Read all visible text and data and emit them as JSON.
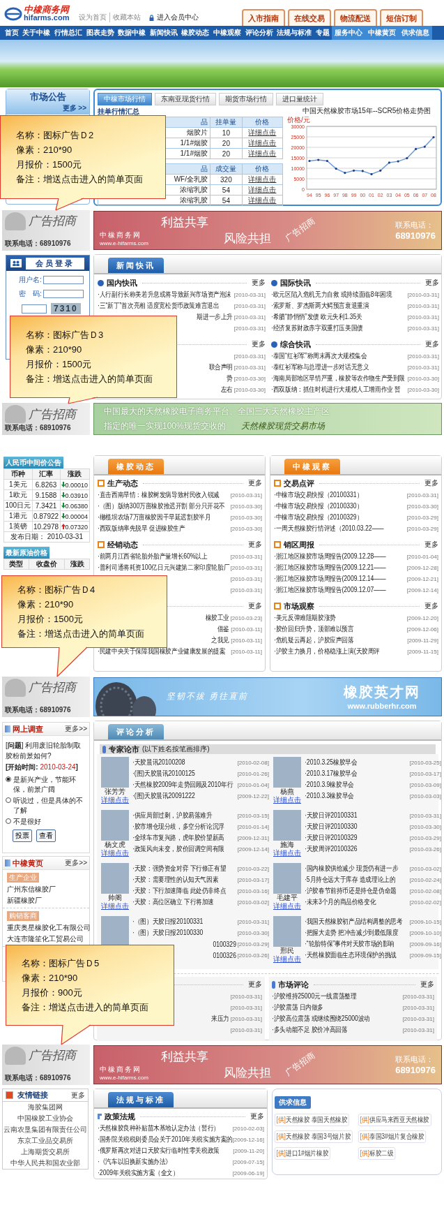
{
  "header": {
    "logo_cn": "中橡商务网",
    "logo_en": "hifarms.com",
    "links": [
      "设为首页",
      "收藏本站"
    ],
    "member_link": "进入会员中心",
    "tabs": [
      "入市指南",
      "在线交易",
      "物流配送",
      "短信订制"
    ]
  },
  "nav": [
    {
      "label": "首页",
      "highlighted": false
    },
    {
      "label": "关于中橡",
      "highlighted": false
    },
    {
      "label": "行情总汇",
      "highlighted": false
    },
    {
      "label": "图表走势",
      "highlighted": false
    },
    {
      "label": "数据中橡",
      "highlighted": false
    },
    {
      "label": "新闻快讯",
      "highlighted": false
    },
    {
      "label": "橡胶动态",
      "highlighted": false
    },
    {
      "label": "中橡观察",
      "highlighted": false
    },
    {
      "label": "评论分析",
      "highlighted": false
    },
    {
      "label": "法规与标准",
      "highlighted": false
    },
    {
      "label": "专题",
      "highlighted": false
    },
    {
      "label": "服务中心",
      "highlighted": true
    },
    {
      "label": "中橡黄页",
      "highlighted": true
    },
    {
      "label": "供求信息",
      "highlighted": true
    }
  ],
  "notice": {
    "title": "市场公告",
    "more": "更多 >>"
  },
  "market": {
    "tabs": [
      {
        "label": "中橡市场行情",
        "selected": true
      },
      {
        "label": "东南亚现货行情",
        "selected": false
      },
      {
        "label": "期货市场行情",
        "selected": false
      },
      {
        "label": "进口量统计",
        "selected": false
      }
    ],
    "subtitle": "挂单行情汇总",
    "tables": [
      {
        "columns": [
          "品",
          "挂单量",
          "价格"
        ],
        "rows": [
          [
            "烟胶片",
            "10",
            "详细点击"
          ],
          [
            "1/1#烟胶",
            "20",
            "详细点击"
          ],
          [
            "1/1#烟胶",
            "20",
            "详细点击"
          ]
        ]
      },
      {
        "columns": [
          "品",
          "成交量",
          "价格"
        ],
        "rows": [
          [
            "WF/全乳胶",
            "320",
            "详细点击"
          ],
          [
            "浓缩乳胶",
            "54",
            "详细点击"
          ],
          [
            "浓缩乳胶",
            "54",
            "详细点击"
          ]
        ]
      }
    ],
    "chart_data": {
      "type": "line",
      "title": "中国天然橡胶市场15年--SCR5价格走势图",
      "ylabel": "价格/元",
      "categories": [
        "94",
        "95",
        "96",
        "97",
        "98",
        "99",
        "00",
        "01",
        "02",
        "03",
        "04",
        "05",
        "06",
        "07",
        "08"
      ],
      "series": [
        {
          "color": "#6a9ad8",
          "values": [
            13500,
            14000,
            13500,
            9800,
            7800,
            8900,
            8700,
            7200,
            8900,
            12700,
            13300,
            14800,
            19200,
            20300,
            24800
          ]
        }
      ],
      "ylim": [
        0,
        30000
      ],
      "grid": true,
      "yticks": [
        0,
        5000,
        10000,
        15000,
        20000,
        25000,
        30000
      ]
    }
  },
  "ads": [
    {
      "kind": "profit",
      "side_title": "广告招商",
      "side_phone": "联系电话：68910976",
      "slogan_1": "利益共享",
      "slogan_2": "风险共担",
      "brand": "中橡商务网",
      "url": "www.e-hifarms.com",
      "stamp": "广告招商",
      "contact_label": "联系电话：",
      "contact_phone": "68910976"
    },
    {
      "kind": "market",
      "side_title": "广告招商",
      "side_phone": "联系电话：68910976",
      "line_1": "中国最大的天然橡胶电子商务平台、全国三大天然橡胶主产区",
      "line_2": "指定的唯一实现100%现货交收的",
      "line_3": "天然橡胶现货交易市场"
    },
    {
      "kind": "jobs",
      "side_title": "广告招商",
      "side_phone": "联系电话：68910976",
      "slogan": "坚韧不拔 勇往直前",
      "title": "橡胶英才网",
      "url": "www.rubberhr.com"
    },
    {
      "kind": "profit",
      "side_title": "广告招商",
      "side_phone": "联系电话：68910976",
      "slogan_1": "利益共享",
      "slogan_2": "风险共担",
      "brand": "中橡商务网",
      "url": "www.e-hifarms.com",
      "stamp": "广告招商",
      "contact_label": "联系电话：",
      "contact_phone": "68910976"
    }
  ],
  "login": {
    "title": "会员登录",
    "username_label": "用户名:",
    "password_label": "密　码:",
    "captcha": "7310"
  },
  "news": {
    "tab": "新闻快讯",
    "columns": [
      [
        {
          "title": "国内快讯",
          "more": "更多",
          "items": [
            {
              "text": "·人行副行长称美若升息或将导致新兴市场资产泡沫",
              "date": "[2010-03-31]"
            },
            {
              "text": "·三“新丁”首次亮相 适度宽松货币政策难言退出",
              "date": "[2010-03-31]"
            },
            {
              "text": "期进一步上升",
              "covered": true,
              "date": "[2010-03-31]"
            },
            {
              "date": "[2010-03-31]"
            }
          ]
        },
        {
          "more": "更多",
          "items": [
            {
              "date": "[2010-03-31]"
            },
            {
              "text": "联合声明",
              "covered": true,
              "date": "[2010-03-31]"
            },
            {
              "text": "势",
              "covered": true,
              "date": "[2010-03-30]"
            },
            {
              "text": "左右",
              "covered": true,
              "date": "[2010-03-30]"
            }
          ]
        }
      ],
      [
        {
          "title": "国际快讯",
          "more": "更多",
          "items": [
            {
              "text": "·欧元区陷入危机无力自救 或持续面临8年困境",
              "date": "[2010-03-31]"
            },
            {
              "text": "·索罗斯、罗杰斯两大鳄预言衰退重演",
              "date": "[2010-03-31]"
            },
            {
              "text": "·希腊“静悄悄”发债 欧元失利1.35关",
              "date": "[2010-03-31]"
            },
            {
              "text": "·经济复苏财政赤字双重打压美国债",
              "date": "[2010-03-31]"
            }
          ]
        },
        {
          "title": "综合快讯",
          "more": "更多",
          "items": [
            {
              "text": "·泰国“红衫军”称周末再次大规模集会",
              "date": "[2010-03-31]"
            },
            {
              "text": "·泰红衫军称与总理进一步对话无意义",
              "date": "[2010-03-31]"
            },
            {
              "text": "·海南局部地区旱情严重，橡胶等农作物生产受到限",
              "date": "[2010-03-30]"
            },
            {
              "text": "·西双版纳：抓住时机进行大规模人工增雨作业 暂",
              "date": "[2010-03-30]"
            }
          ]
        }
      ]
    ]
  },
  "rates": {
    "title": "人民币中间价公告",
    "columns": [
      "币种",
      "汇率",
      "涨跌"
    ],
    "rows": [
      {
        "currency": "1美元",
        "rate": "6.8263",
        "change": "0.00010",
        "kind": "down"
      },
      {
        "currency": "1欧元",
        "rate": "9.1588",
        "change": "0.03910",
        "kind": "down"
      },
      {
        "currency": "100日元",
        "rate": "7.3421",
        "change": "0.06380",
        "kind": "down"
      },
      {
        "currency": "1港元",
        "rate": "0.87922",
        "change": "0.00004",
        "kind": "down"
      },
      {
        "currency": "1英镑",
        "rate": "10.2978",
        "change": "0.07320",
        "kind": "up"
      }
    ],
    "footer": "发布日期： 2010-03-31"
  },
  "oil": {
    "title": "最新原油价格",
    "columns": [
      "类型",
      "收盘价",
      "涨跌"
    ]
  },
  "dynamics": {
    "tab": "橡胶动态",
    "sections": [
      {
        "title": "生产动态",
        "more": "更多",
        "items": [
          {
            "text": "·直击西南旱情：橡胶树发病导致村民收入锐减",
            "date": "[2010-03-31]"
          },
          {
            "text": "·（图）版纳300万亩橡胶推迟开割 部分只开花不",
            "date": "[2010-03-30]"
          },
          {
            "text": "·橄榄坝农场7万亩橡胶因干旱延迟割胶半月",
            "date": "[2010-03-30]"
          },
          {
            "text": "·西双版纳率先脱旱 促进橡胶生产",
            "date": "[2010-03-30]"
          }
        ]
      },
      {
        "title": "经销动态",
        "more": "更多",
        "items": [
          {
            "text": "·前两月江西省轮胎外胎产量增长60%以上",
            "date": "[2010-03-31]"
          },
          {
            "text": "·普利司通将耗资100亿日元兴建第二家印度轮胎厂",
            "date": "[2010-03-31]"
          },
          {
            "date": "[2010-03-31]"
          },
          {
            "date": "[2010-03-31]"
          }
        ]
      },
      {
        "more": "更多",
        "items": [
          {
            "text": "橡胶工业",
            "covered": true,
            "date": "[2010-03-23]"
          },
          {
            "text": "借鉴",
            "covered": true,
            "date": "[2010-03-11]"
          },
          {
            "text": "之我见",
            "covered": true,
            "date": "[2010-03-11]"
          },
          {
            "text": "·民建中央关于保障我国橡胶产业健康发展的提案",
            "date": "[2010-03-11]"
          }
        ]
      }
    ]
  },
  "observation": {
    "tab": "中橡观察",
    "sections": [
      {
        "title": "交易点评",
        "more": "更多",
        "items": [
          {
            "text": "·中橡市场交易快报（20100331）",
            "date": "[2010-03-31]"
          },
          {
            "text": "·中橡市场交易快报（20100330）",
            "date": "[2010-03-30]"
          },
          {
            "text": "·中橡市场交易快报（20100329）",
            "date": "[2010-03-29]"
          },
          {
            "text": "·一周天然橡胶行情评述（2010.03.22——",
            "date": "[2010-03-29]"
          }
        ]
      },
      {
        "title": "销区周报",
        "more": "更多",
        "items": [
          {
            "text": "·浙江地区橡胶市场周报告(2009.12.28——",
            "date": "[2010-01-04]"
          },
          {
            "text": "·浙江地区橡胶市场周报告(2009.12.21——",
            "date": "[2009-12-28]"
          },
          {
            "text": "·浙江地区橡胶市场周报告(2009.12.14——",
            "date": "[2009-12-21]"
          },
          {
            "text": "·浙江地区橡胶市场周报告(2009.12.07——",
            "date": "[2009-12-14]"
          }
        ]
      },
      {
        "title": "市场观察",
        "more": "更多",
        "items": [
          {
            "text": "·美元反弹难阻期胶涨势",
            "date": "[2009-12-20]"
          },
          {
            "text": "·胶价回归升势，顶部难以预言",
            "date": "[2009-12-06]"
          },
          {
            "text": "·危机疑云再起，沪胶应声回落",
            "date": "[2009-11-29]"
          },
          {
            "text": "·沪胶主力换月，价格稳涨上演(天胶周评",
            "date": "[2009-11-15]"
          }
        ]
      }
    ]
  },
  "survey": {
    "title": "网上调查",
    "more": "更多>>",
    "question": "[**问题**] 利用废旧轮胎制取胶粉前景如何?",
    "start_label": "[开始时间: ",
    "start_date": "2010-03-24",
    "start_end": "]",
    "options": [
      {
        "label": "是新兴产业，节能环保，前景广阔",
        "selected": true
      },
      {
        "label": "听说过，但是具体的不了解",
        "selected": false
      },
      {
        "label": "不是很好",
        "selected": false
      }
    ],
    "buttons": [
      "投票",
      "查看"
    ]
  },
  "yellow_pages": {
    "title": "中橡黄页",
    "more": "更多>>",
    "groups": [
      {
        "tag": "生产企业",
        "items": [
          "广州东信橡胶厂",
          "新疆橡胶厂"
        ]
      },
      {
        "tag": "购销客商",
        "items": [
          "重庆奥星橡胶化工有限公司",
          "大连市隆笙化工贸易公司"
        ]
      }
    ]
  },
  "comments": {
    "tab": "评论分析",
    "experts_title": "专家论市",
    "experts_note": "(以下姓名按笔画排序)",
    "experts": [
      {
        "name": "张芳芳",
        "link": "详细点击",
        "items": [
          {
            "text": "·天胶晨讯20100208",
            "date": "[2010-02-08]"
          },
          {
            "text": "·(图)天胶晨讯20100125",
            "date": "[2010-01-26]"
          },
          {
            "text": "·天然橡胶2009年走势回顾及2010年行",
            "date": "[2010-01-04]"
          },
          {
            "text": "·(图)天胶晨讯20091222",
            "date": "[2009-12-22]"
          }
        ]
      },
      {
        "name": "杨燕",
        "link": "详细点击",
        "items": [
          {
            "text": "·2010.3.25橡胶早会",
            "date": "[2010-03-25]"
          },
          {
            "text": "·2010.3.17橡胶早会",
            "date": "[2010-03-17]"
          },
          {
            "text": "·2010.3.9橡胶早会",
            "date": "[2010-03-09]"
          },
          {
            "text": "·2010.3.3橡胶早会",
            "date": "[2010-03-03]"
          }
        ]
      },
      {
        "name": "杨文虎",
        "link": "详细点击",
        "items": [
          {
            "text": "·供应局部过剩，沪胶易落难升",
            "date": "[2010-03-15]"
          },
          {
            "text": "·胶市增仓现分歧，多空分析论沉浮",
            "date": "[2010-01-14]"
          },
          {
            "text": "·全球车市复兴路，虎年胶价望新高",
            "date": "[2009-12-31]"
          },
          {
            "text": "·政策风向未变，胶价回调空间有限",
            "date": "[2009-12-14]"
          }
        ]
      },
      {
        "name": "施海",
        "link": "详细点击",
        "items": [
          {
            "text": "·天胶日评20100331",
            "date": "[2010-03-31]"
          },
          {
            "text": "·天胶日评20100330",
            "date": "[2010-03-30]"
          },
          {
            "text": "·天胶日评20100329",
            "date": "[2010-03-29]"
          },
          {
            "text": "·天胶周评20100326",
            "date": "[2010-03-26]"
          }
        ]
      },
      {
        "name": "帅阁",
        "link": "详细点击",
        "items": [
          {
            "text": "·天胶：强势资金对弈 下行修正有望",
            "date": "[2010-03-22]"
          },
          {
            "text": "·天胶：需要理性的认知天气因素",
            "date": "[2010-03-17]"
          },
          {
            "text": "·天胶：下行加速降临 此处仍非终点",
            "date": "[2010-03-16]"
          },
          {
            "text": "·天胶：高位区确立 下行将加速",
            "date": "[2010-03-02]"
          }
        ]
      },
      {
        "name": "毛建平",
        "link": "详细点击",
        "items": [
          {
            "text": "·国内橡胶供给减少 现货仍有进一步",
            "date": "[2010-03-02]"
          },
          {
            "text": "·5月持仓远大于库存 造成理论上的",
            "date": "[2010-02-24]"
          },
          {
            "text": "·沪胶春节前持币还是持仓是伪命题",
            "date": "[2010-02-08]"
          },
          {
            "text": "·未来3个月的商品价格变化",
            "date": "[2010-02-02]"
          }
        ]
      },
      {
        "items": [
          {
            "text": "·（图）天胶日报20100331",
            "date": "[2010-03-31]"
          },
          {
            "text": "·（图）天胶日报20100330",
            "date": "[2010-03-30]"
          },
          {
            "text": "0100329",
            "covered": true,
            "date": "[2010-03-29]"
          },
          {
            "text": "0100326",
            "covered": true,
            "date": "[2010-03-26]"
          }
        ]
      },
      {
        "name": "邢民",
        "link": "详细点击",
        "items": [
          {
            "text": "·我国天然橡胶初产品结构调整的思考",
            "date": "[2009-10-15]"
          },
          {
            "text": "·把握大走势 把冲击减少到最低限度",
            "date": "[2009-10-10]"
          },
          {
            "text": "·“轮胎特保”事件对天胶市场的影响",
            "date": "[2009-09-16]"
          },
          {
            "text": "·天然橡胶面临生态环境保护的挑战",
            "date": "[2009-09-15]"
          }
        ]
      }
    ],
    "boxes": [
      {
        "more": "更多",
        "items": [
          {
            "date": "[2010-03-31]"
          },
          {
            "date": "[2010-03-31]"
          },
          {
            "text": "来压力",
            "covered": true,
            "date": "[2010-03-31]"
          },
          {
            "date": "[2010-03-31]"
          }
        ]
      },
      {
        "title": "市场评论",
        "more": "更多",
        "items": [
          {
            "text": "·沪胶维持25000元一线震荡整理",
            "date": "[2010-03-31]"
          },
          {
            "text": "·沪胶震荡 日内做多",
            "date": "[2010-03-31]"
          },
          {
            "text": "·沪胶高位震荡 或继续围绕25000波动",
            "date": "[2010-03-31]"
          },
          {
            "text": "·多头动能不足 胶价冲高回落",
            "date": "[2010-03-31]"
          }
        ]
      }
    ]
  },
  "friend_links": {
    "title": "友情链接",
    "more": "更多",
    "items": [
      "海胶集团网",
      "中国橡胶工业协会",
      "云南农垦集团有限责任公司",
      "东京工业品交易所",
      "上海期货交易所",
      "中华人民共和国农业部"
    ]
  },
  "laws": {
    "tab": "法规与标准",
    "section": {
      "title": "政策法规",
      "more": "更多",
      "items": [
        {
          "text": "·天然橡胶良种补贴苗木基地认定办法（暂行）",
          "date": "[2010-02-03]"
        },
        {
          "text": "·国务院关税税则委员会关于2010年关税实施方案的",
          "date": "[2009-12-16]"
        },
        {
          "text": "·俄罗斯再次对进口天胶实行临时性零关税政策",
          "date": "[2009-11-20]"
        },
        {
          "text": "·《汽车以旧换新实施办法》",
          "date": "[2009-07-15]"
        },
        {
          "text": "·2009年关税实施方案（全文）",
          "date": "[2009-06-19]"
        }
      ]
    }
  },
  "supply": {
    "title": "供求信息",
    "items": [
      {
        "tag": "[供]",
        "text": "天然橡胶 泰国天然橡胶"
      },
      {
        "tag": "[供]",
        "text": "供应马来西亚天然橡胶"
      },
      {
        "tag": "[供]",
        "text": "天然橡胶 泰国3号烟片胶"
      },
      {
        "tag": "[供]",
        "text": "泰国3#烟片复合橡胶"
      },
      {
        "tag": "[供]",
        "text": "进口1#烟片橡胶"
      },
      {
        "tag": "[供]",
        "text": "标胶二级"
      }
    ]
  },
  "callouts": [
    {
      "lines": [
        "名称：图标广告Ｄ2",
        "像素：210*90",
        "月报价：1500元",
        "备注：增送点击进入的简单页面"
      ]
    },
    {
      "lines": [
        "名称：图标广告Ｄ3",
        "像素：210*90",
        "月报价：1500元",
        "备注：增送点击进入的简单页面"
      ]
    },
    {
      "lines": [
        "名称：图标广告Ｄ4",
        "像素：210*90",
        "月报价：1500元",
        "备注：增送点击进入的简单页面"
      ]
    },
    {
      "lines": [
        "名称：图标广告Ｄ5",
        "像素：210*90",
        "月报价：900元",
        "备注：增送点击进入的简单页面"
      ]
    }
  ]
}
